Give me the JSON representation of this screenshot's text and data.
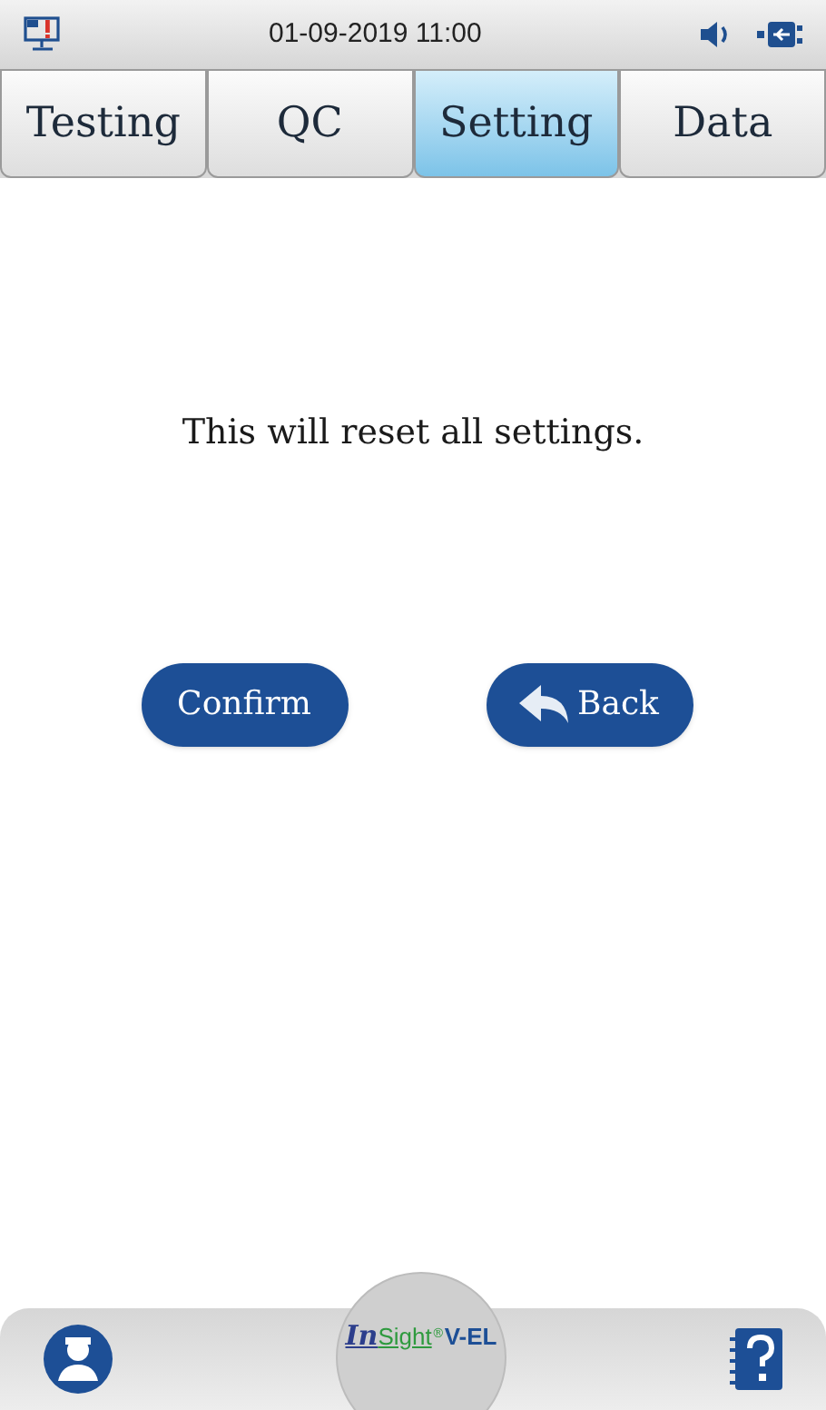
{
  "status_bar": {
    "datetime": "01-09-2019  11:00"
  },
  "tabs": [
    {
      "label": "Testing",
      "selected": false
    },
    {
      "label": "QC",
      "selected": false
    },
    {
      "label": "Setting",
      "selected": true
    },
    {
      "label": "Data",
      "selected": false
    }
  ],
  "message": "This will reset all settings.",
  "buttons": [
    {
      "kind": "plain",
      "label": "Confirm"
    },
    {
      "kind": "back",
      "label": "Back"
    }
  ],
  "logo": {
    "prefix": "In",
    "name": "Sight",
    "mark": "®",
    "suffix": "V-EL"
  }
}
